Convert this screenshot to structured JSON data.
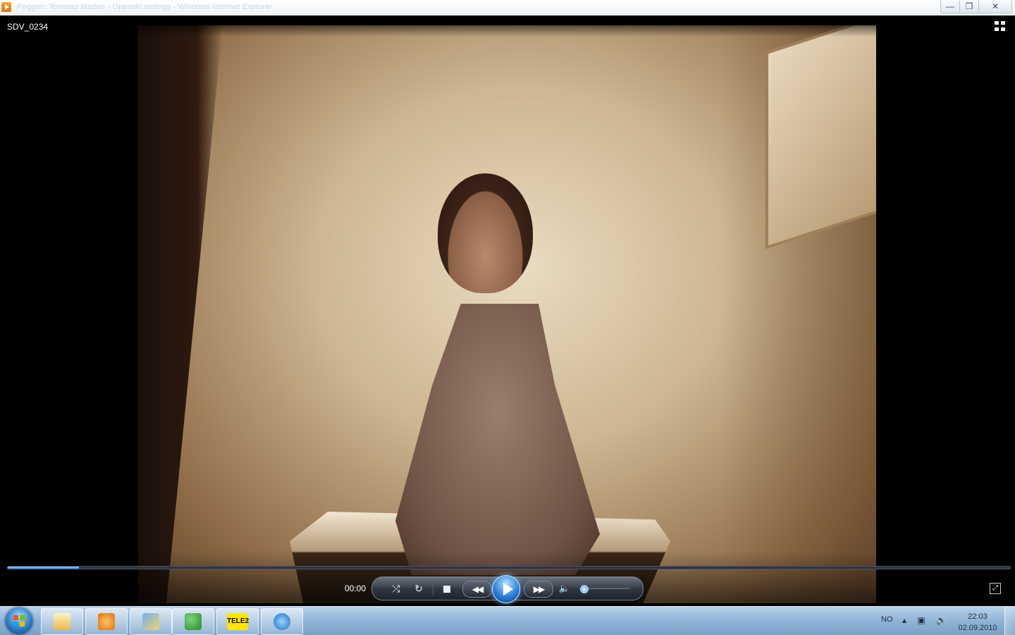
{
  "window": {
    "title": "Poggan: Tomsiaz Maden - Oppvekt innlegg - Windows Internet Explorer",
    "minimize_glyph": "—",
    "maximize_glyph": "❐",
    "close_glyph": "✕"
  },
  "player": {
    "media_name": "SDV_0234",
    "time": "00:00",
    "seek_progress": 0.071,
    "volume_level": 0.0,
    "play_icon": "play-icon",
    "controls": {
      "shuffle": "⤮",
      "repeat": "↻",
      "prev": "◀◀",
      "next": "▶▶",
      "mute": "🔈",
      "fullscreen": "⤢"
    },
    "accent": "#2a80d8"
  },
  "taskbar": {
    "apps": [
      {
        "name": "windows-explorer",
        "icon": "folder-icon"
      },
      {
        "name": "media-player",
        "icon": "media-player-icon"
      },
      {
        "name": "paint",
        "icon": "paint-icon"
      },
      {
        "name": "messenger",
        "icon": "messenger-icon"
      },
      {
        "name": "tele2",
        "label": "TELE2",
        "icon": "tele2-icon"
      },
      {
        "name": "internet-explorer",
        "icon": "ie-icon"
      }
    ],
    "tray": {
      "language": "NO",
      "icons": "▴ ▣ 🔊",
      "time": "22:03",
      "date": "02.09.2010"
    }
  }
}
